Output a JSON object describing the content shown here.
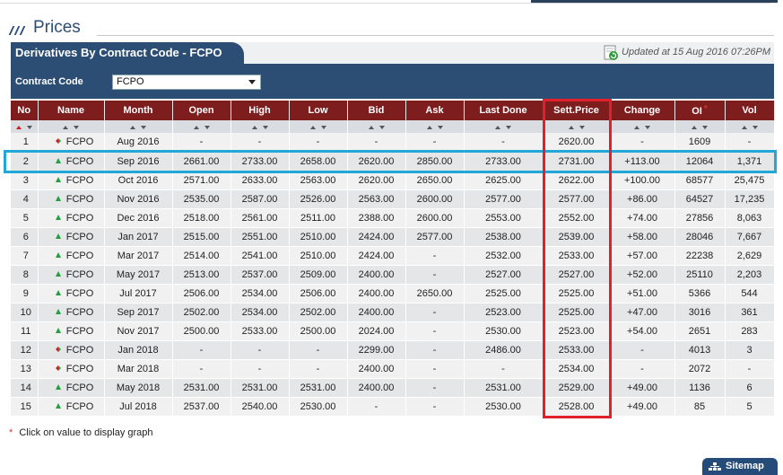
{
  "section_title": "Prices",
  "panel": {
    "title": "Derivatives By Contract Code - FCPO",
    "updated": "Updated at 15 Aug 2016 07:26PM"
  },
  "contract_code": {
    "label": "Contract Code",
    "selected": "FCPO"
  },
  "columns": [
    "No",
    "Name",
    "Month",
    "Open",
    "High",
    "Low",
    "Bid",
    "Ask",
    "Last Done",
    "Sett.Price",
    "Change",
    "OI",
    "Vol"
  ],
  "oi_marker": "*",
  "rows": [
    {
      "no": "1",
      "trend": "mixed",
      "name": "FCPO",
      "month": "Aug 2016",
      "open": "-",
      "high": "-",
      "low": "-",
      "bid": "-",
      "ask": "-",
      "last": "-",
      "sett": "2620.00",
      "change": "-",
      "oi": "1609",
      "vol": "-"
    },
    {
      "no": "2",
      "trend": "up",
      "name": "FCPO",
      "month": "Sep 2016",
      "open": "2661.00",
      "high": "2733.00",
      "low": "2658.00",
      "bid": "2620.00",
      "ask": "2850.00",
      "last": "2733.00",
      "sett": "2731.00",
      "change": "+113.00",
      "oi": "12064",
      "vol": "1,371"
    },
    {
      "no": "3",
      "trend": "up",
      "name": "FCPO",
      "month": "Oct 2016",
      "open": "2571.00",
      "high": "2633.00",
      "low": "2563.00",
      "bid": "2620.00",
      "ask": "2650.00",
      "last": "2625.00",
      "sett": "2622.00",
      "change": "+100.00",
      "oi": "68577",
      "vol": "25,475"
    },
    {
      "no": "4",
      "trend": "up",
      "name": "FCPO",
      "month": "Nov 2016",
      "open": "2535.00",
      "high": "2587.00",
      "low": "2526.00",
      "bid": "2563.00",
      "ask": "2600.00",
      "last": "2577.00",
      "sett": "2577.00",
      "change": "+86.00",
      "oi": "64527",
      "vol": "17,235"
    },
    {
      "no": "5",
      "trend": "up",
      "name": "FCPO",
      "month": "Dec 2016",
      "open": "2518.00",
      "high": "2561.00",
      "low": "2511.00",
      "bid": "2388.00",
      "ask": "2600.00",
      "last": "2553.00",
      "sett": "2552.00",
      "change": "+74.00",
      "oi": "27856",
      "vol": "8,063"
    },
    {
      "no": "6",
      "trend": "up",
      "name": "FCPO",
      "month": "Jan 2017",
      "open": "2515.00",
      "high": "2551.00",
      "low": "2510.00",
      "bid": "2424.00",
      "ask": "2577.00",
      "last": "2538.00",
      "sett": "2539.00",
      "change": "+58.00",
      "oi": "28046",
      "vol": "7,667"
    },
    {
      "no": "7",
      "trend": "up",
      "name": "FCPO",
      "month": "Mar 2017",
      "open": "2514.00",
      "high": "2541.00",
      "low": "2510.00",
      "bid": "2424.00",
      "ask": "-",
      "last": "2532.00",
      "sett": "2533.00",
      "change": "+57.00",
      "oi": "22238",
      "vol": "2,629"
    },
    {
      "no": "8",
      "trend": "up",
      "name": "FCPO",
      "month": "May 2017",
      "open": "2513.00",
      "high": "2537.00",
      "low": "2509.00",
      "bid": "2400.00",
      "ask": "-",
      "last": "2527.00",
      "sett": "2527.00",
      "change": "+52.00",
      "oi": "25110",
      "vol": "2,203"
    },
    {
      "no": "9",
      "trend": "up",
      "name": "FCPO",
      "month": "Jul 2017",
      "open": "2506.00",
      "high": "2534.00",
      "low": "2506.00",
      "bid": "2400.00",
      "ask": "2650.00",
      "last": "2525.00",
      "sett": "2525.00",
      "change": "+51.00",
      "oi": "5366",
      "vol": "544"
    },
    {
      "no": "10",
      "trend": "up",
      "name": "FCPO",
      "month": "Sep 2017",
      "open": "2502.00",
      "high": "2534.00",
      "low": "2502.00",
      "bid": "2400.00",
      "ask": "-",
      "last": "2523.00",
      "sett": "2525.00",
      "change": "+47.00",
      "oi": "3016",
      "vol": "361"
    },
    {
      "no": "11",
      "trend": "up",
      "name": "FCPO",
      "month": "Nov 2017",
      "open": "2500.00",
      "high": "2533.00",
      "low": "2500.00",
      "bid": "2024.00",
      "ask": "-",
      "last": "2530.00",
      "sett": "2523.00",
      "change": "+54.00",
      "oi": "2651",
      "vol": "283"
    },
    {
      "no": "12",
      "trend": "mixed",
      "name": "FCPO",
      "month": "Jan 2018",
      "open": "-",
      "high": "-",
      "low": "-",
      "bid": "2299.00",
      "ask": "-",
      "last": "2486.00",
      "sett": "2533.00",
      "change": "-",
      "oi": "4013",
      "vol": "3"
    },
    {
      "no": "13",
      "trend": "mixed",
      "name": "FCPO",
      "month": "Mar 2018",
      "open": "-",
      "high": "-",
      "low": "-",
      "bid": "2400.00",
      "ask": "-",
      "last": "-",
      "sett": "2534.00",
      "change": "-",
      "oi": "2072",
      "vol": "-"
    },
    {
      "no": "14",
      "trend": "up",
      "name": "FCPO",
      "month": "May 2018",
      "open": "2531.00",
      "high": "2531.00",
      "low": "2531.00",
      "bid": "2400.00",
      "ask": "-",
      "last": "2531.00",
      "sett": "2529.00",
      "change": "+49.00",
      "oi": "1136",
      "vol": "6"
    },
    {
      "no": "15",
      "trend": "up",
      "name": "FCPO",
      "month": "Jul 2018",
      "open": "2537.00",
      "high": "2540.00",
      "low": "2530.00",
      "bid": "-",
      "ask": "-",
      "last": "2530.00",
      "sett": "2528.00",
      "change": "+49.00",
      "oi": "85",
      "vol": "5"
    }
  ],
  "footnote": {
    "marker": "*",
    "text": "Click on value to display graph"
  },
  "sitemap_label": "Sitemap",
  "colors": {
    "header_bg": "#7d1d1d",
    "panel_bg": "#2c4e74",
    "change_positive": "#1c8c2c",
    "oi_link": "#2344c8",
    "highlight_row": "#22a8d8",
    "highlight_column": "#e0202a"
  },
  "icons": {
    "refresh": "refresh-icon",
    "trend_up": "trend-up-icon",
    "trend_mixed": "trend-mixed-icon",
    "sitemap": "sitemap-icon",
    "dropdown": "chevron-down-icon"
  }
}
